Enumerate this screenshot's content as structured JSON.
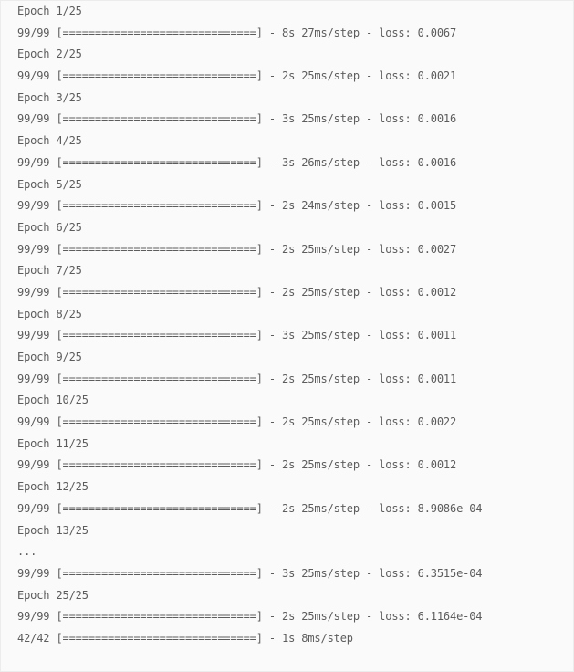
{
  "output": {
    "lines": [
      "Epoch 1/25",
      "99/99 [==============================] - 8s 27ms/step - loss: 0.0067",
      "Epoch 2/25",
      "99/99 [==============================] - 2s 25ms/step - loss: 0.0021",
      "Epoch 3/25",
      "99/99 [==============================] - 3s 25ms/step - loss: 0.0016",
      "Epoch 4/25",
      "99/99 [==============================] - 3s 26ms/step - loss: 0.0016",
      "Epoch 5/25",
      "99/99 [==============================] - 2s 24ms/step - loss: 0.0015",
      "Epoch 6/25",
      "99/99 [==============================] - 2s 25ms/step - loss: 0.0027",
      "Epoch 7/25",
      "99/99 [==============================] - 2s 25ms/step - loss: 0.0012",
      "Epoch 8/25",
      "99/99 [==============================] - 3s 25ms/step - loss: 0.0011",
      "Epoch 9/25",
      "99/99 [==============================] - 2s 25ms/step - loss: 0.0011",
      "Epoch 10/25",
      "99/99 [==============================] - 2s 25ms/step - loss: 0.0022",
      "Epoch 11/25",
      "99/99 [==============================] - 2s 25ms/step - loss: 0.0012",
      "Epoch 12/25",
      "99/99 [==============================] - 2s 25ms/step - loss: 8.9086e-04",
      "Epoch 13/25",
      "...",
      "99/99 [==============================] - 3s 25ms/step - loss: 6.3515e-04",
      "Epoch 25/25",
      "99/99 [==============================] - 2s 25ms/step - loss: 6.1164e-04",
      "42/42 [==============================] - 1s 8ms/step"
    ]
  }
}
